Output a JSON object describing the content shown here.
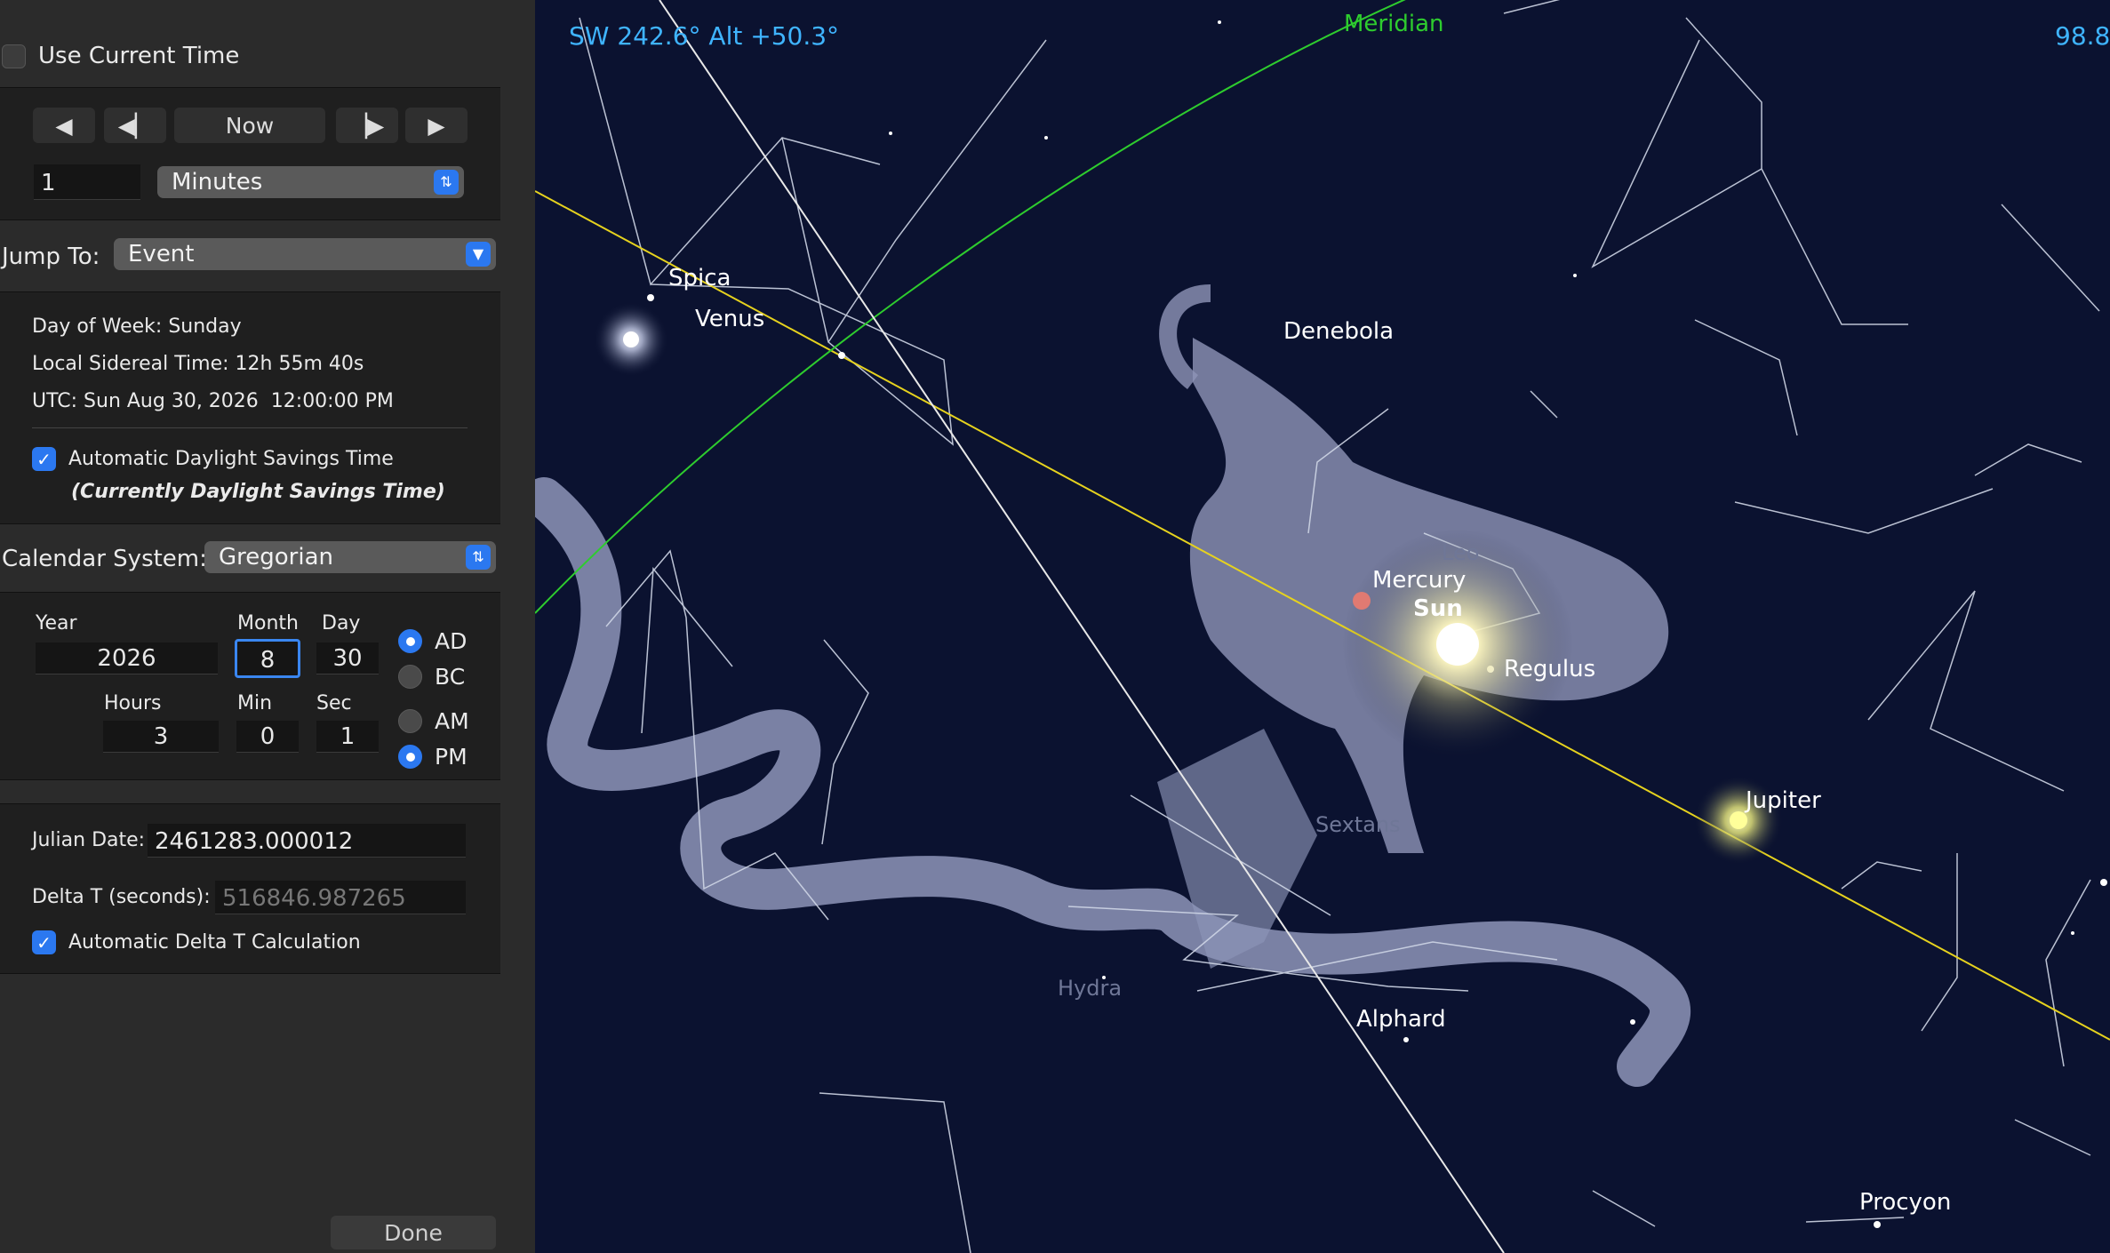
{
  "panel": {
    "use_current_time_label": "Use Current Time",
    "use_current_time_checked": false,
    "now_label": "Now",
    "step_value": "1",
    "step_unit": "Minutes",
    "jump_to_label": "Jump To:",
    "jump_to_value": "Event",
    "day_of_week_label": "Day of Week:",
    "day_of_week_value": "Sunday",
    "lst_label": "Local Sidereal Time:",
    "lst_value": "12h 55m 40s",
    "utc_label": "UTC:",
    "utc_value": "Sun Aug 30, 2026  12:00:00 PM",
    "auto_dst_label": "Automatic Daylight Savings Time",
    "auto_dst_checked": true,
    "dst_note": "(Currently Daylight Savings Time)",
    "calendar_label": "Calendar System:",
    "calendar_value": "Gregorian",
    "year_label": "Year",
    "month_label": "Month",
    "day_label": "Day",
    "year_value": "2026",
    "month_value": "8",
    "day_value": "30",
    "hours_label": "Hours",
    "min_label": "Min",
    "sec_label": "Sec",
    "hours_value": "3",
    "min_value": "0",
    "sec_value": "1",
    "ad_label": "AD",
    "bc_label": "BC",
    "am_label": "AM",
    "pm_label": "PM",
    "era_selected": "AD",
    "meridiem_selected": "PM",
    "julian_label": "Julian Date:",
    "julian_value": "2461283.000012",
    "delta_t_label": "Delta T (seconds):",
    "delta_t_value": "516846.987265",
    "auto_delta_t_label": "Automatic Delta T Calculation",
    "auto_delta_t_checked": true,
    "done_label": "Done"
  },
  "sky": {
    "direction_readout": "SW 242.6° Alt +50.3°",
    "fov_readout": "98.8",
    "meridian_label": "Meridian",
    "objects": {
      "spica": "Spica",
      "venus": "Venus",
      "denebola": "Denebola",
      "mercury": "Mercury",
      "sun": "Sun",
      "regulus": "Regulus",
      "jupiter": "Jupiter",
      "alphard": "Alphard",
      "procyon": "Procyon",
      "leo": "Leo",
      "sextans": "Sextans",
      "hydra": "Hydra"
    },
    "colors": {
      "background": "#0b1230",
      "meridian": "#2ecc2e",
      "ecliptic": "#e6d21e",
      "readout": "#3fb4ff",
      "constellation_lines": "#cfd6e6"
    }
  }
}
